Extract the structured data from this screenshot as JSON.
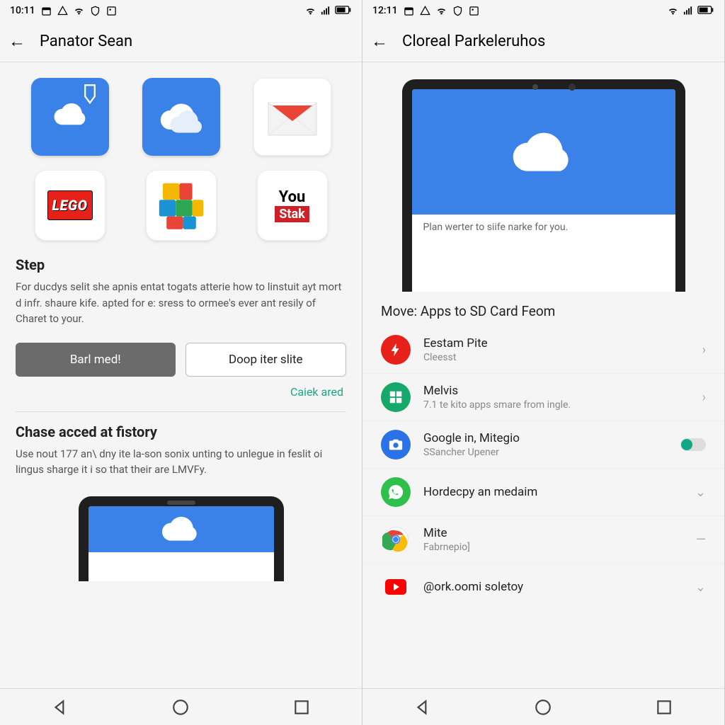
{
  "left": {
    "status": {
      "time": "10:11"
    },
    "appbar": {
      "title": "Panator Sean"
    },
    "apps": [
      "cloud-download",
      "cloud",
      "mail",
      "lego",
      "blocks",
      "youstak"
    ],
    "logos": {
      "lego": "LEGO",
      "youstak_top": "You",
      "youstak_bottom": "Stak"
    },
    "step": {
      "heading": "Step",
      "body": "For ducdys selit she apnis entat togats atterie how to linstuit ayt mort d infr. shaure kife. apted for e: sress to ormee's ever ant resily of Charet to your."
    },
    "buttons": {
      "primary": "Barl med!",
      "secondary": "Doop iter slite"
    },
    "link": "Caiek ared",
    "history": {
      "heading": "Chase acced at fistory",
      "body": "Use nout 177 an\\ dny ite la-son sonix unting to unlegue in feslit oi lingus sharge it i so that their are LMVFy."
    }
  },
  "right": {
    "status": {
      "time": "12:11"
    },
    "appbar": {
      "title": "Cloreal Parkeleruhos"
    },
    "hero_caption": "Plan werter to siife narke for you.",
    "list": {
      "heading": "Move: Apps to SD Card Feom",
      "items": [
        {
          "title": "Eestam Pite",
          "sub": "Cleesst",
          "icon": "bolt",
          "color": "#e8201a",
          "trailing": "chev"
        },
        {
          "title": "Melvis",
          "sub": "7.1 te kito apps smare from ingle.",
          "icon": "grid",
          "color": "#16a86a",
          "trailing": "chev"
        },
        {
          "title": "Google in, Mitegio",
          "sub": "SSancher Upener",
          "icon": "camera",
          "color": "#2b72e6",
          "trailing": "toggle"
        },
        {
          "title": "Hordecpy an medaim",
          "sub": "",
          "icon": "whatsapp",
          "color": "#2ec04a",
          "trailing": "down"
        },
        {
          "title": "Mite",
          "sub": "Fabrnepio]",
          "icon": "chrome",
          "color": "",
          "trailing": "dash"
        },
        {
          "title": "@ork.oomi soletoy",
          "sub": "",
          "icon": "youtube",
          "color": "#ff0000",
          "trailing": "down"
        }
      ]
    }
  }
}
